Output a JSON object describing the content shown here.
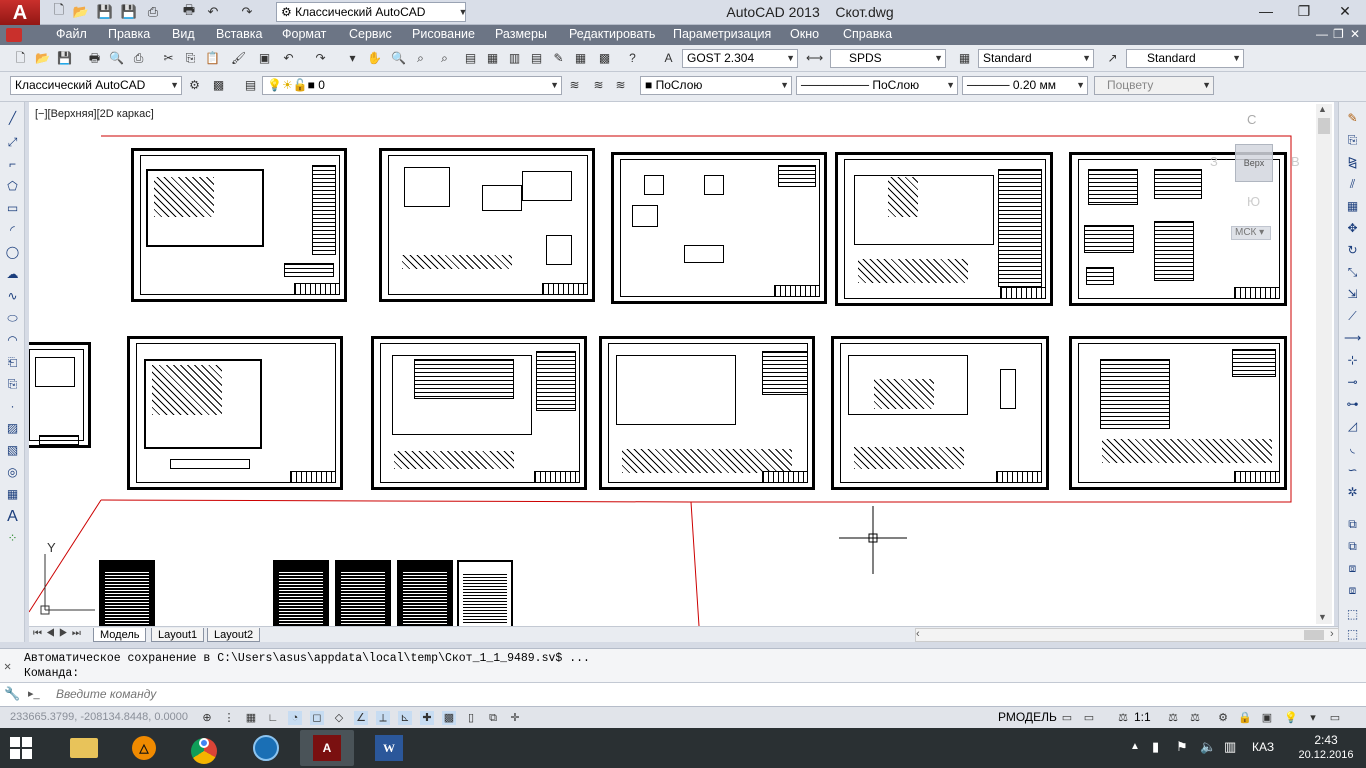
{
  "title_bar": {
    "app_title": "AutoCAD 2013",
    "file_name": "Скот.dwg",
    "workspace": "Классический AutoCAD",
    "app_logo": "A"
  },
  "menu": {
    "items": [
      "Файл",
      "Правка",
      "Вид",
      "Вставка",
      "Формат",
      "Сервис",
      "Рисование",
      "Размеры",
      "Редактировать",
      "Параметризация",
      "Окно",
      "Справка"
    ]
  },
  "toolbar_standard": {
    "text_style": "GOST 2.304",
    "dim_style": "SPDS",
    "table_style": "Standard",
    "mleader_style": "Standard"
  },
  "toolbar_layers": {
    "workspace": "Классический AutoCAD",
    "layer": "0",
    "color": "ПоСлою",
    "linetype": "ПоСлою",
    "lineweight": "0.20 мм",
    "plotstyle": "Поцвету"
  },
  "viewport": {
    "label": "[−][Верхняя][2D каркас]",
    "viewcube_face": "Верх",
    "compass_n": "С",
    "compass_e": "В",
    "compass_w": "З",
    "compass_s": "Ю",
    "ucs_label": "МСК",
    "ucs_y": "Y"
  },
  "tabs": [
    "Модель",
    "Layout1",
    "Layout2"
  ],
  "command": {
    "history": "Автоматическое сохранение в C:\\Users\\asus\\appdata\\local\\temp\\Скот_1_1_9489.sv$ ...",
    "prompt": "Команда:",
    "input_placeholder": "Введите команду"
  },
  "status": {
    "coordinates": "233665.3799, -208134.8448, 0.0000",
    "space": "РМОДЕЛЬ",
    "scale": "1:1"
  },
  "taskbar": {
    "language": "КАЗ",
    "time": "2:43",
    "date": "20.12.2016"
  },
  "colors": {
    "menubar": "#6c7585",
    "limits_line": "#cc0000",
    "taskbar": "#2a3033"
  }
}
